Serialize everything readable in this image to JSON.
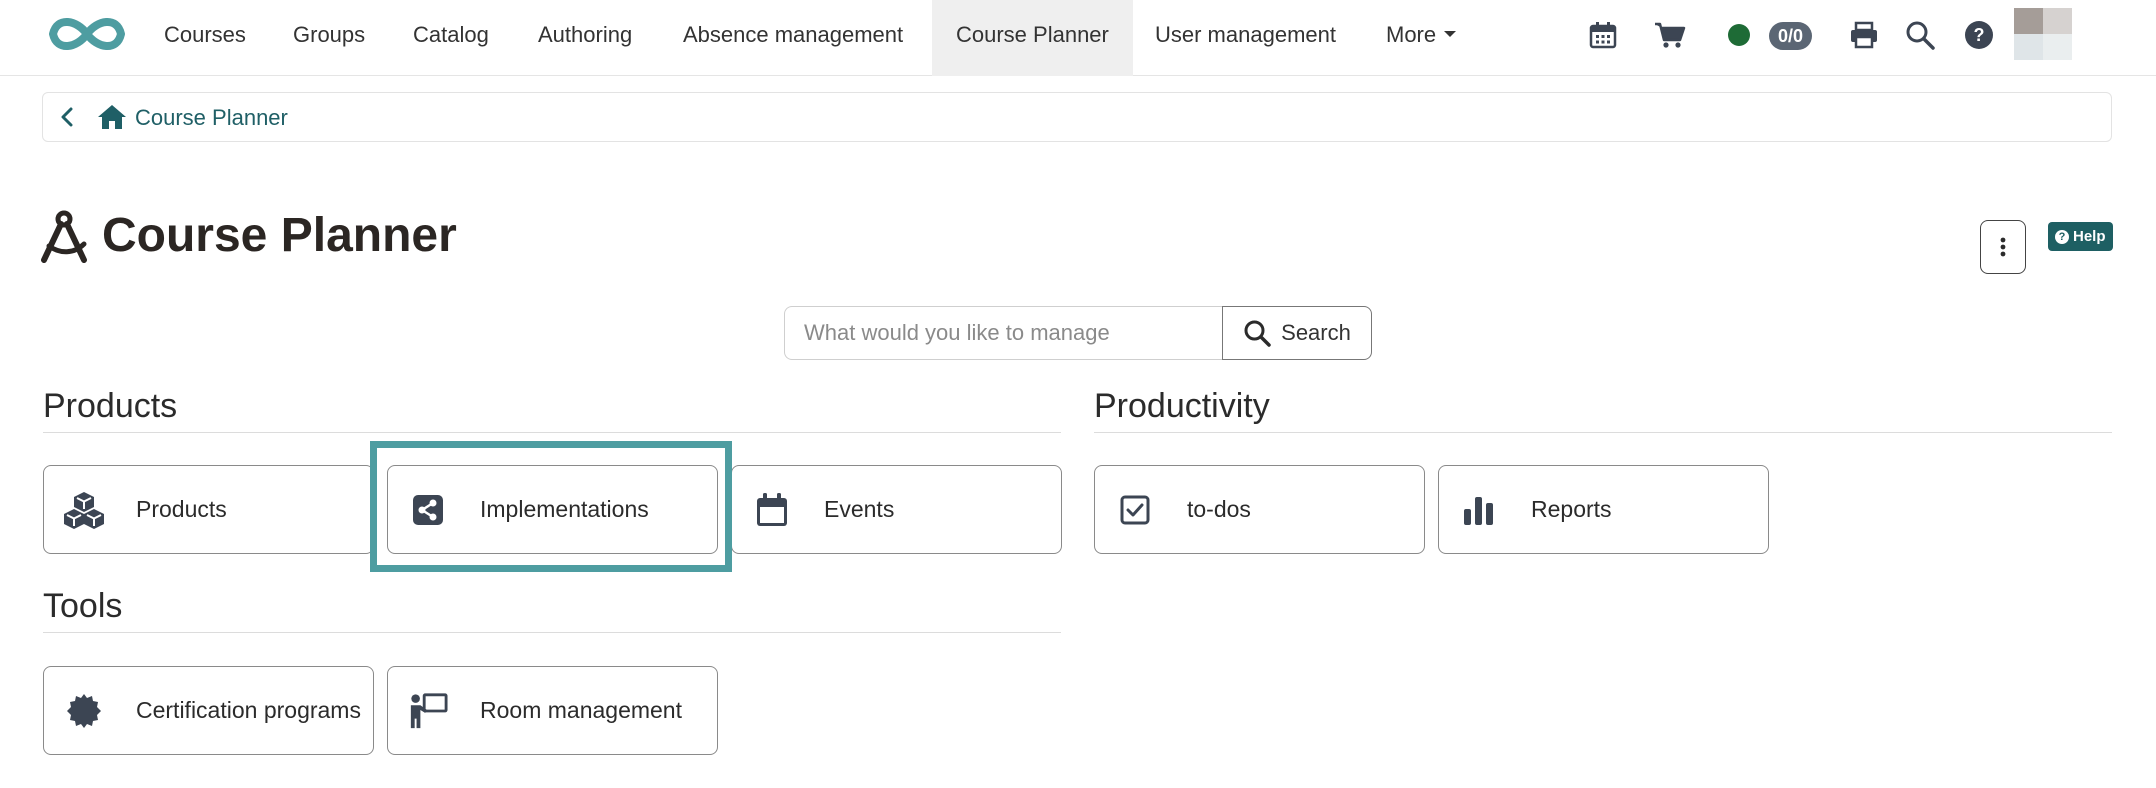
{
  "nav": {
    "items": [
      {
        "label": "Courses"
      },
      {
        "label": "Groups"
      },
      {
        "label": "Catalog"
      },
      {
        "label": "Authoring"
      },
      {
        "label": "Absence management"
      },
      {
        "label": "Course Planner"
      },
      {
        "label": "User management"
      },
      {
        "label": "More"
      }
    ],
    "active": "Course Planner",
    "counter": "0/0",
    "icons": [
      "calendar-icon",
      "cart-icon",
      "status-online-icon",
      "print-icon",
      "search-icon",
      "help-icon"
    ]
  },
  "breadcrumb": {
    "current": "Course Planner"
  },
  "page": {
    "title": "Course Planner",
    "help_label": "Help"
  },
  "search": {
    "placeholder": "What would you like to manage",
    "value": "",
    "button_label": "Search"
  },
  "sections": {
    "products": {
      "title": "Products",
      "tiles": [
        {
          "label": "Products",
          "icon": "cubes-icon"
        },
        {
          "label": "Implementations",
          "icon": "share-icon",
          "highlighted": true
        },
        {
          "label": "Events",
          "icon": "calendar-icon"
        }
      ]
    },
    "productivity": {
      "title": "Productivity",
      "tiles": [
        {
          "label": "to-dos",
          "icon": "checkbox-icon"
        },
        {
          "label": "Reports",
          "icon": "bar-chart-icon"
        }
      ]
    },
    "tools": {
      "title": "Tools",
      "tiles": [
        {
          "label": "Certification programs",
          "icon": "certificate-icon"
        },
        {
          "label": "Room management",
          "icon": "presenter-icon"
        }
      ]
    }
  },
  "colors": {
    "brand": "#4e9da1",
    "highlight": "#4e9da1",
    "link": "#1f5f66",
    "help_bg": "#1e5f63",
    "status_online": "#1e6b36",
    "active_tab_bg": "#efefef"
  }
}
